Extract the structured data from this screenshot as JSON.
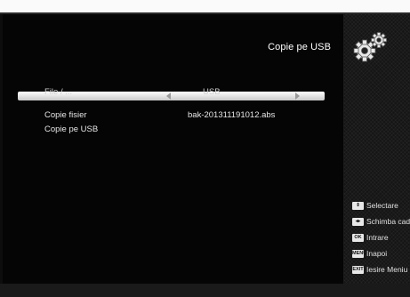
{
  "title": "Copie pe USB",
  "menu": {
    "items": [
      {
        "label": "File / ...",
        "value": "USB",
        "selected": true
      },
      {
        "label": "Copie fisier",
        "value": "bak-201311191012.abs",
        "selected": false
      },
      {
        "label": "Copie pe USB",
        "value": "",
        "selected": false
      }
    ]
  },
  "help": [
    {
      "key": "⇕",
      "label": "Selectare"
    },
    {
      "key": "◂▸",
      "label": "Schimba cadru"
    },
    {
      "key": "OK",
      "label": "Intrare"
    },
    {
      "key": "MENU",
      "label": "Inapoi"
    },
    {
      "key": "EXIT",
      "label": "Iesire Meniu"
    }
  ],
  "colors": {
    "background": "#0d0d0d",
    "selection": "#ffffff",
    "text": "#e6e6e6"
  },
  "icons": [
    "gear-icon",
    "arrow-left-icon",
    "arrow-right-icon"
  ]
}
